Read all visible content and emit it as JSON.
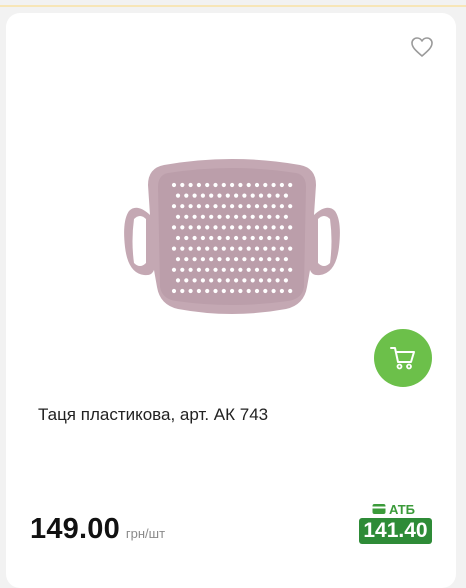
{
  "product": {
    "title": "Таця пластикова, арт. АК 743",
    "image_icon": "plastic-tray-image",
    "tray_color": "#c4a8b3",
    "price": "149.00",
    "unit": "грн/шт",
    "promo": {
      "store_label": "АТБ",
      "store_icon": "wallet-card-icon",
      "price": "141.40",
      "color": "#2e8b37"
    }
  },
  "actions": {
    "favorite_icon": "heart-outline-icon",
    "cart_icon": "shopping-cart-icon",
    "cart_button_color": "#6cc04a"
  }
}
